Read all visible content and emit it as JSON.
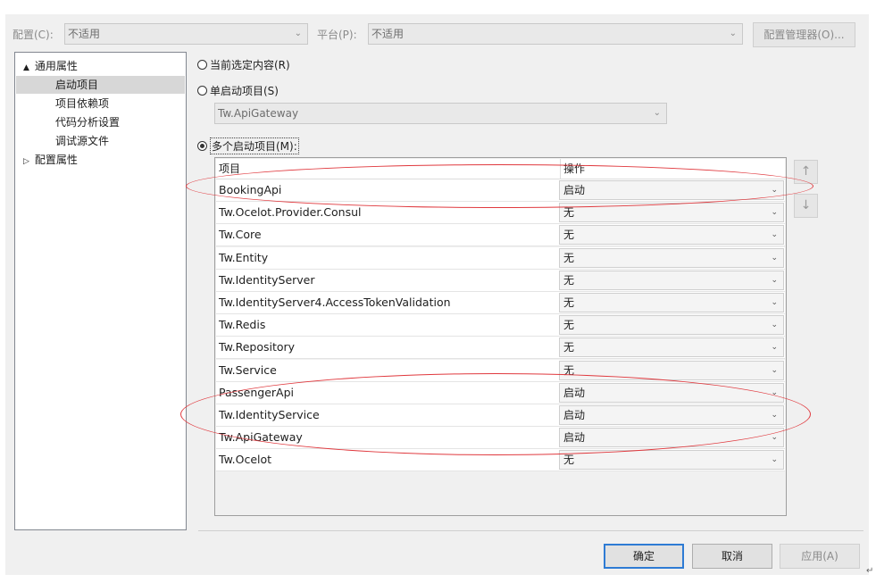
{
  "top_bar": {
    "config_label": "配置(C):",
    "config_value": "不适用",
    "platform_label": "平台(P):",
    "platform_value": "不适用",
    "config_manager_label": "配置管理器(O)..."
  },
  "tree": {
    "items": [
      {
        "label": "通用属性",
        "expander": "▲"
      },
      {
        "label": "启动项目"
      },
      {
        "label": "项目依赖项"
      },
      {
        "label": "代码分析设置"
      },
      {
        "label": "调试源文件"
      },
      {
        "label": "配置属性",
        "expander": "▷"
      }
    ]
  },
  "startup": {
    "current_selection_label": "当前选定内容(R)",
    "single_label": "单启动项目(S)",
    "single_value": "Tw.ApiGateway",
    "multiple_label": "多个启动项目(M):",
    "selected": "multiple"
  },
  "grid": {
    "col_project": "项目",
    "col_action": "操作",
    "rows": [
      {
        "name": "BookingApi",
        "action": "启动"
      },
      {
        "name": "Tw.Ocelot.Provider.Consul",
        "action": "无"
      },
      {
        "name": "Tw.Core",
        "action": "无"
      },
      {
        "name": "Tw.Entity",
        "action": "无"
      },
      {
        "name": "Tw.IdentityServer",
        "action": "无"
      },
      {
        "name": "Tw.IdentityServer4.AccessTokenValidation",
        "action": "无"
      },
      {
        "name": "Tw.Redis",
        "action": "无"
      },
      {
        "name": "Tw.Repository",
        "action": "无"
      },
      {
        "name": "Tw.Service",
        "action": "无"
      },
      {
        "name": "PassengerApi",
        "action": "启动"
      },
      {
        "name": "Tw.IdentityService",
        "action": "启动"
      },
      {
        "name": "Tw.ApiGateway",
        "action": "启动"
      },
      {
        "name": "Tw.Ocelot",
        "action": "无"
      }
    ]
  },
  "buttons": {
    "ok": "确定",
    "cancel": "取消",
    "apply": "应用(A)"
  },
  "colors": {
    "annotation": "#e0393e",
    "focus_border": "#2e7bd4"
  }
}
